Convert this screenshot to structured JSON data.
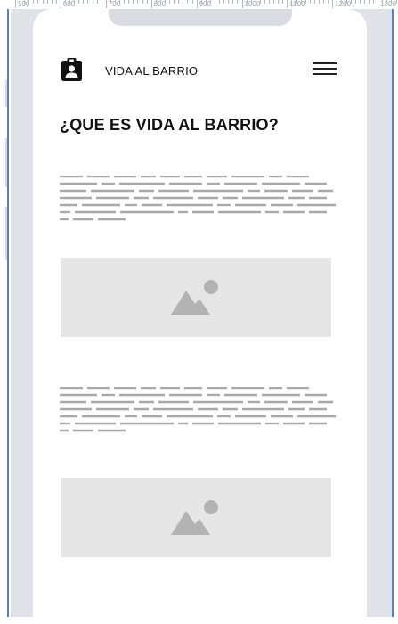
{
  "ruler": {
    "labels": [
      "500",
      "600",
      "700",
      "800",
      "900",
      "1000",
      "1100",
      "1200",
      "1300"
    ]
  },
  "header": {
    "brand": "VIDA AL BARRIO",
    "logo_icon": "clipboard-user-icon",
    "menu_icon": "hamburger-menu-icon"
  },
  "main": {
    "title": "¿QUE ES VIDA AL BARRIO?",
    "image_icon": "image-placeholder-icon"
  },
  "colors": {
    "frame": "#dfe2e7",
    "guide": "#5b7fc4",
    "placeholder": "#e6e6e6",
    "placeholder_icon": "#b3b3b3",
    "text_lines": "#a9a9a9"
  }
}
